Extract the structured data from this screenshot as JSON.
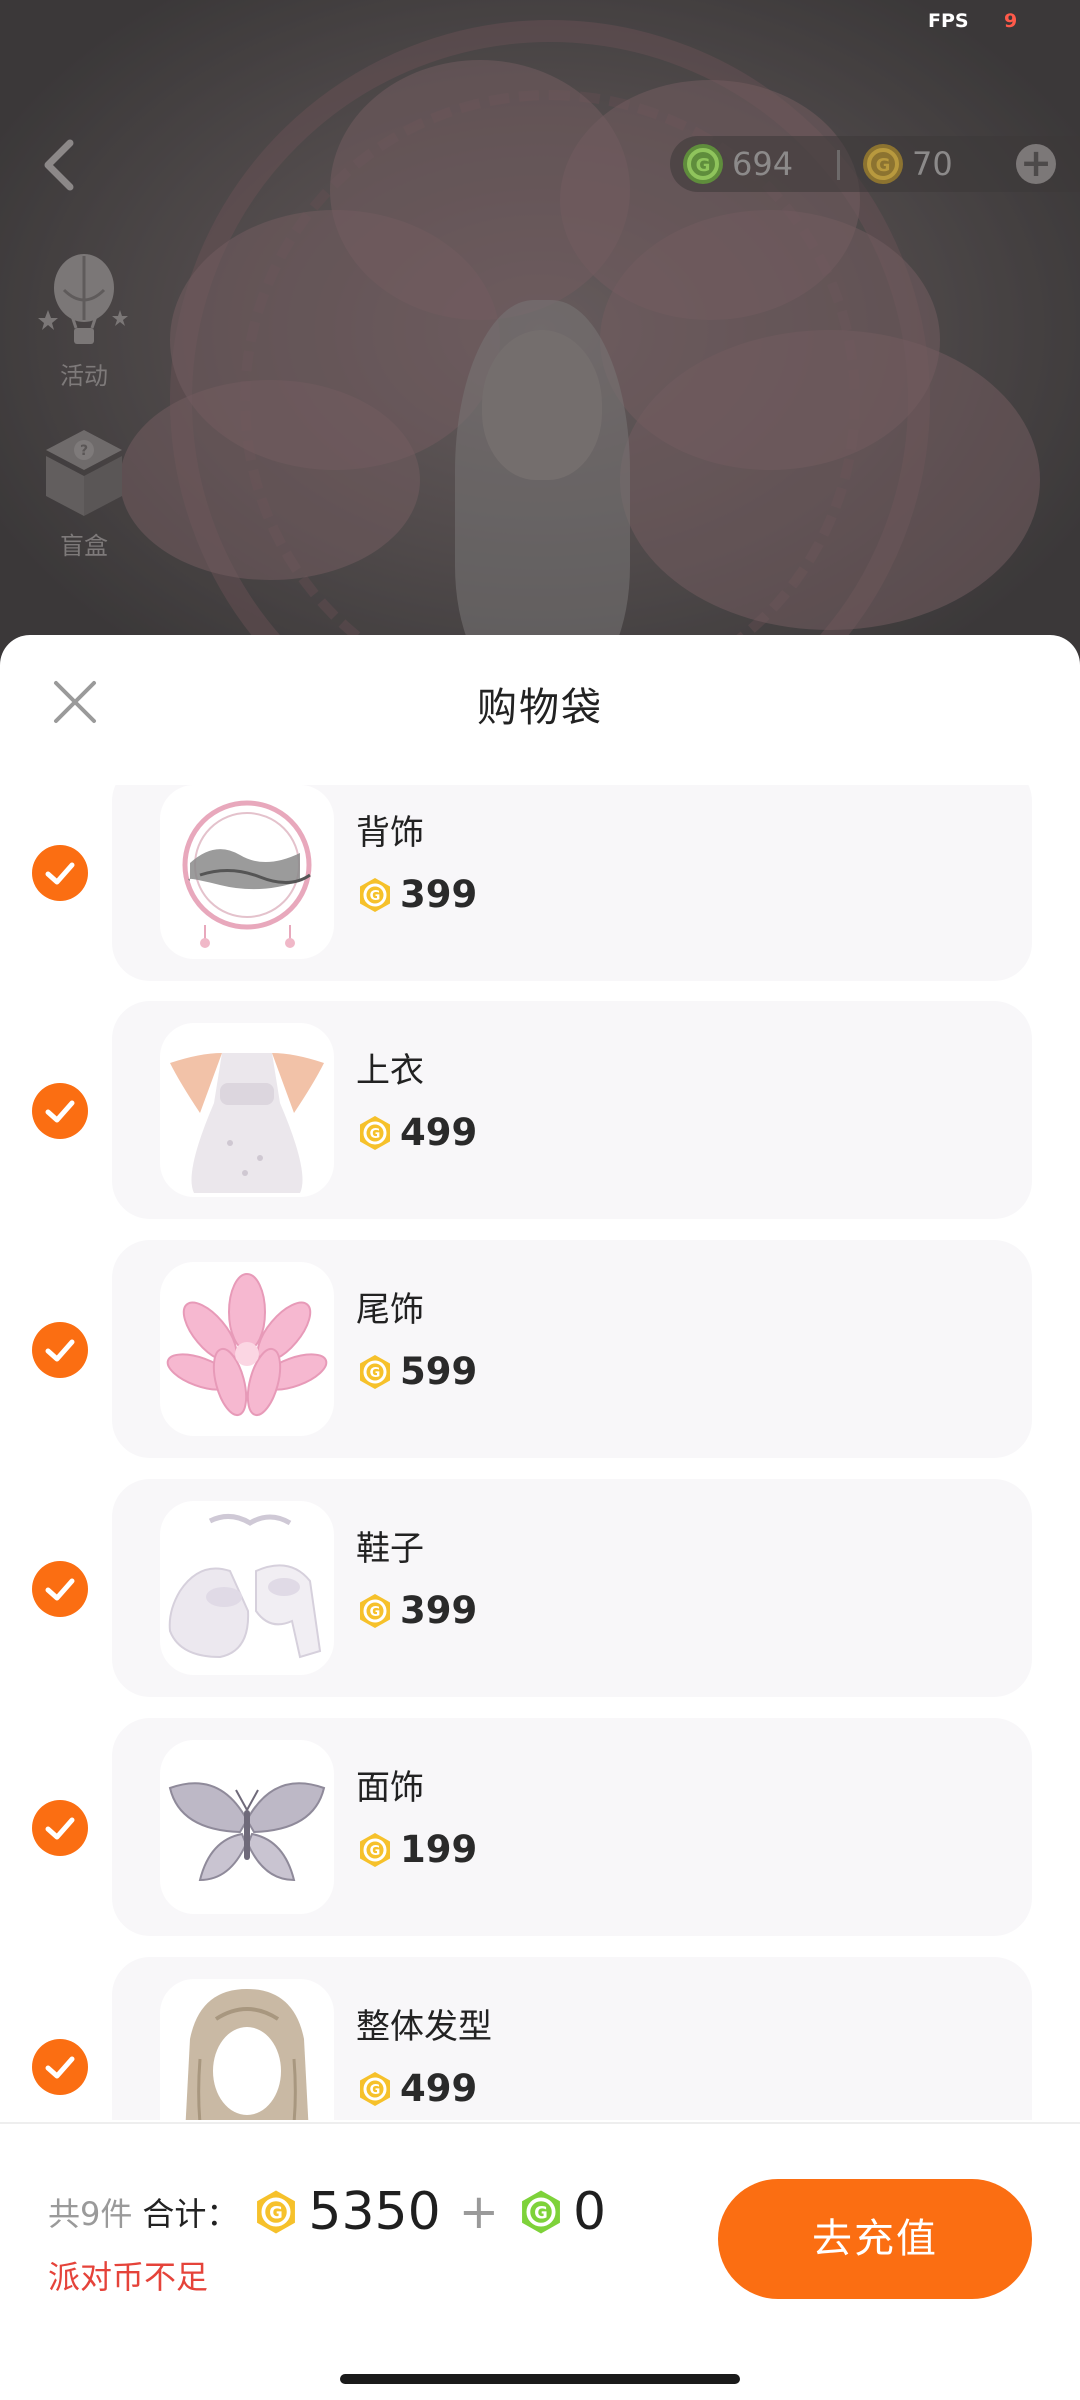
{
  "status": {
    "fps_label": "FPS",
    "fps_value": "9"
  },
  "currency": {
    "green_coin_amount": "694",
    "gold_coin_amount": "70",
    "add_label": "+"
  },
  "side_menu": [
    {
      "label": "活动",
      "icon": "hot-air-balloon-icon"
    },
    {
      "label": "盲盒",
      "icon": "blind-box-icon"
    }
  ],
  "sheet": {
    "title": "购物袋",
    "items": [
      {
        "name": "背饰",
        "price": "399",
        "thumb": "back-accessory-icon"
      },
      {
        "name": "上衣",
        "price": "499",
        "thumb": "dress-icon"
      },
      {
        "name": "尾饰",
        "price": "599",
        "thumb": "tail-accessory-icon"
      },
      {
        "name": "鞋子",
        "price": "399",
        "thumb": "shoes-icon"
      },
      {
        "name": "面饰",
        "price": "199",
        "thumb": "butterfly-icon"
      },
      {
        "name": "整体发型",
        "price": "499",
        "thumb": "hairstyle-icon"
      }
    ]
  },
  "footer": {
    "count_text": "共9件",
    "total_label": "合计：",
    "gold_total": "5350",
    "plus": "+",
    "green_total": "0",
    "warning": "派对币不足",
    "recharge_label": "去充值"
  },
  "colors": {
    "accent": "#fb6e12",
    "warning": "#e5433a",
    "coin_gold": "#f6c12b",
    "coin_green": "#7ed23a"
  }
}
